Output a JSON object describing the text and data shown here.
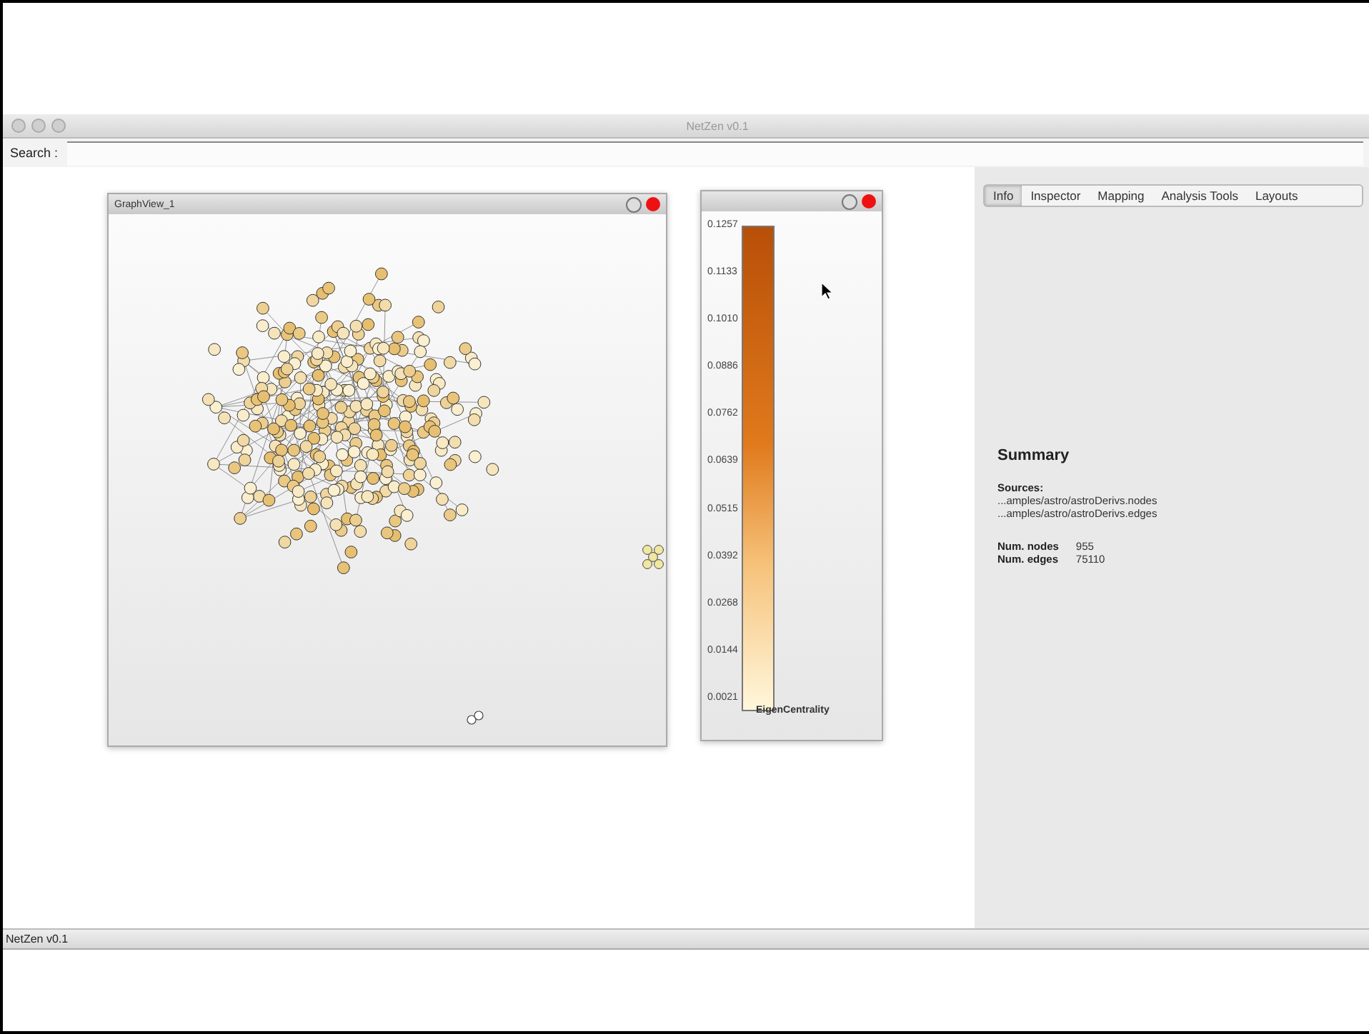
{
  "window": {
    "title": "NetZen v0.1"
  },
  "search": {
    "label": "Search :"
  },
  "graph_view": {
    "title": "GraphView_1"
  },
  "legend": {
    "attribute": "EigenCentrality",
    "ticks": [
      "0.1257",
      "0.1133",
      "0.1010",
      "0.0886",
      "0.0762",
      "0.0639",
      "0.0515",
      "0.0392",
      "0.0268",
      "0.0144",
      "0.0021"
    ]
  },
  "tabs": [
    {
      "label": "Info",
      "selected": true
    },
    {
      "label": "Inspector",
      "selected": false
    },
    {
      "label": "Mapping",
      "selected": false
    },
    {
      "label": "Analysis Tools",
      "selected": false
    },
    {
      "label": "Layouts",
      "selected": false
    }
  ],
  "summary": {
    "heading": "Summary",
    "sources_label": "Sources:",
    "sources": [
      "...amples/astro/astroDerivs.nodes",
      "...amples/astro/astroDerivs.edges"
    ],
    "stats": [
      {
        "label": "Num. nodes",
        "value": "955"
      },
      {
        "label": "Num. edges",
        "value": "75110"
      }
    ]
  },
  "status_bar": {
    "text": "NetZen v0.1"
  }
}
